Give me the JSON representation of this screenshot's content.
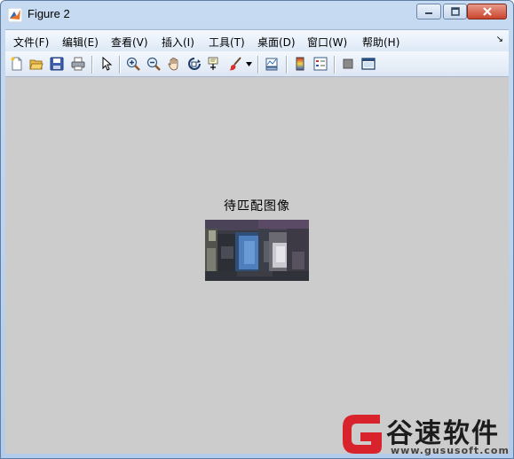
{
  "window": {
    "title": "Figure 2",
    "icon": "matlab-icon"
  },
  "menubar": {
    "items": [
      "文件(F)",
      "编辑(E)",
      "查看(V)",
      "插入(I)",
      "工具(T)",
      "桌面(D)",
      "窗口(W)",
      "帮助(H)"
    ],
    "overflow_symbol": "↘"
  },
  "toolbar": {
    "icons": [
      "new-figure-icon",
      "open-file-icon",
      "save-icon",
      "print-icon",
      "edit-plot-arrow-icon",
      "zoom-in-icon",
      "zoom-out-icon",
      "pan-hand-icon",
      "rotate-3d-icon",
      "data-cursor-icon",
      "brush-icon",
      "brush-dropdown-icon",
      "link-plot-icon",
      "colorbar-icon",
      "legend-icon",
      "hide-plot-tools-icon",
      "show-plot-tools-icon"
    ]
  },
  "figure": {
    "image_title": "待匹配图像"
  },
  "watermark": {
    "brand": "谷速软件",
    "url": "www.gususoft.com",
    "logo_color": "#d9232c"
  }
}
